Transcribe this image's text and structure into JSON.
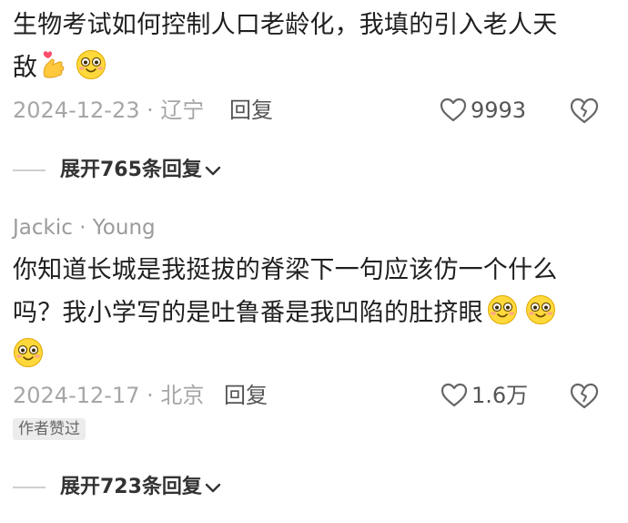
{
  "comments": [
    {
      "text_line1": "生物考试如何控制人口老龄化，我填的引入老人天",
      "text_line2": "敌",
      "date": "2024-12-23",
      "location": "辽宁",
      "reply_label": "回复",
      "like_count": "9993",
      "expand_label": "展开765条回复"
    },
    {
      "username": "Jackic · Young",
      "text_line1": "你知道长城是我挺拔的脊梁下一句应该仿一个什么",
      "text_line2": "吗？我小学写的是吐鲁番是我凹陷的肚挤眼",
      "date": "2024-12-17",
      "location": "北京",
      "reply_label": "回复",
      "like_count": "1.6万",
      "badge": "作者赞过",
      "expand_label": "展开723条回复"
    }
  ],
  "icons": {
    "emoji": "smile-emoji-icon",
    "gesture": "finger-heart-emoji-icon",
    "like": "heart-outline-icon",
    "dislike": "broken-heart-icon",
    "expand": "chevron-down-icon"
  },
  "colors": {
    "text": "#1f1f1f",
    "meta": "#a6a6a6",
    "accent": "#555555"
  }
}
